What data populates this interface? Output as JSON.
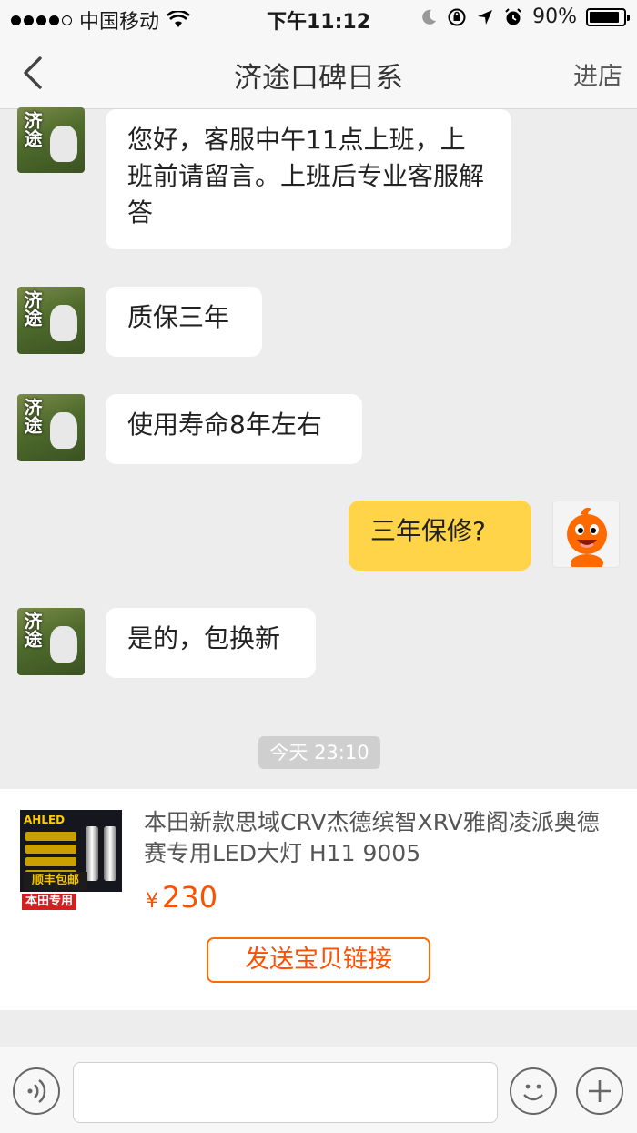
{
  "status_bar": {
    "carrier": "中国移动",
    "time": "下午11:12",
    "battery_percent": "90%",
    "battery_level": 0.9
  },
  "nav": {
    "title": "济途口碑日系",
    "right_label": "进店"
  },
  "shop": {
    "avatar_text": "济途"
  },
  "messages": [
    {
      "from": "shop",
      "text": "您好，客服中午11点上班，上班前请留言。上班后专业客服解答"
    },
    {
      "from": "shop",
      "text": "质保三年"
    },
    {
      "from": "shop",
      "text": "使用寿命8年左右"
    },
    {
      "from": "me",
      "text": "三年保修?"
    },
    {
      "from": "shop",
      "text": "是的，包换新"
    }
  ],
  "timestamp": "今天 23:10",
  "product": {
    "title": "本田新款思域CRV杰德缤智XRV雅阁凌派奥德赛专用LED大灯 H11 9005",
    "currency": "¥",
    "price": "230",
    "send_button": "发送宝贝链接",
    "image_labels": {
      "brand": "本田专用",
      "shipping": "顺丰包邮"
    }
  },
  "input": {
    "placeholder": ""
  },
  "colors": {
    "accent_orange": "#ff5000",
    "my_bubble": "#ffd448",
    "background": "#ededed"
  }
}
